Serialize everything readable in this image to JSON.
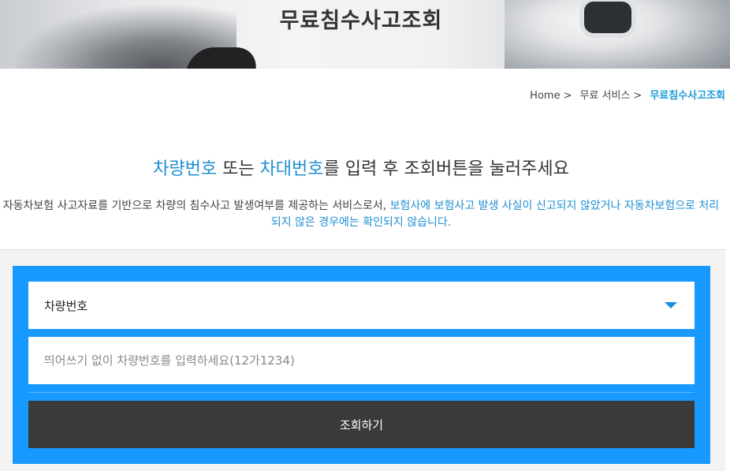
{
  "hero": {
    "title": "무료침수사고조회"
  },
  "breadcrumb": {
    "items": [
      "Home",
      "무료 서비스",
      "무료침수사고조회"
    ],
    "separator": ">"
  },
  "headline": {
    "part1": "차량번호",
    "part2": " 또는 ",
    "part3": "차대번호",
    "part4": "를 입력 후 조회버튼을 눌러주세요"
  },
  "description": {
    "normal": "자동차보험 사고자료를 기반으로 차량의 침수사고 발생여부를 제공하는 서비스로서, ",
    "highlight": "보험사에 보험사고 발생 사실이 신고되지 않았거나 자동차보험으로 처리되지 않은 경우에는 확인되지 않습니다."
  },
  "form": {
    "select_value": "차량번호",
    "input_placeholder": "띄어쓰기 없이 차량번호를 입력하세요(12가1234)",
    "input_value": "",
    "submit_label": "조회하기"
  },
  "colors": {
    "accent": "#1f8fd1",
    "panel": "#1799ff",
    "button": "#3a3a3a"
  },
  "icons": {
    "dropdown": "caret-down-icon"
  }
}
